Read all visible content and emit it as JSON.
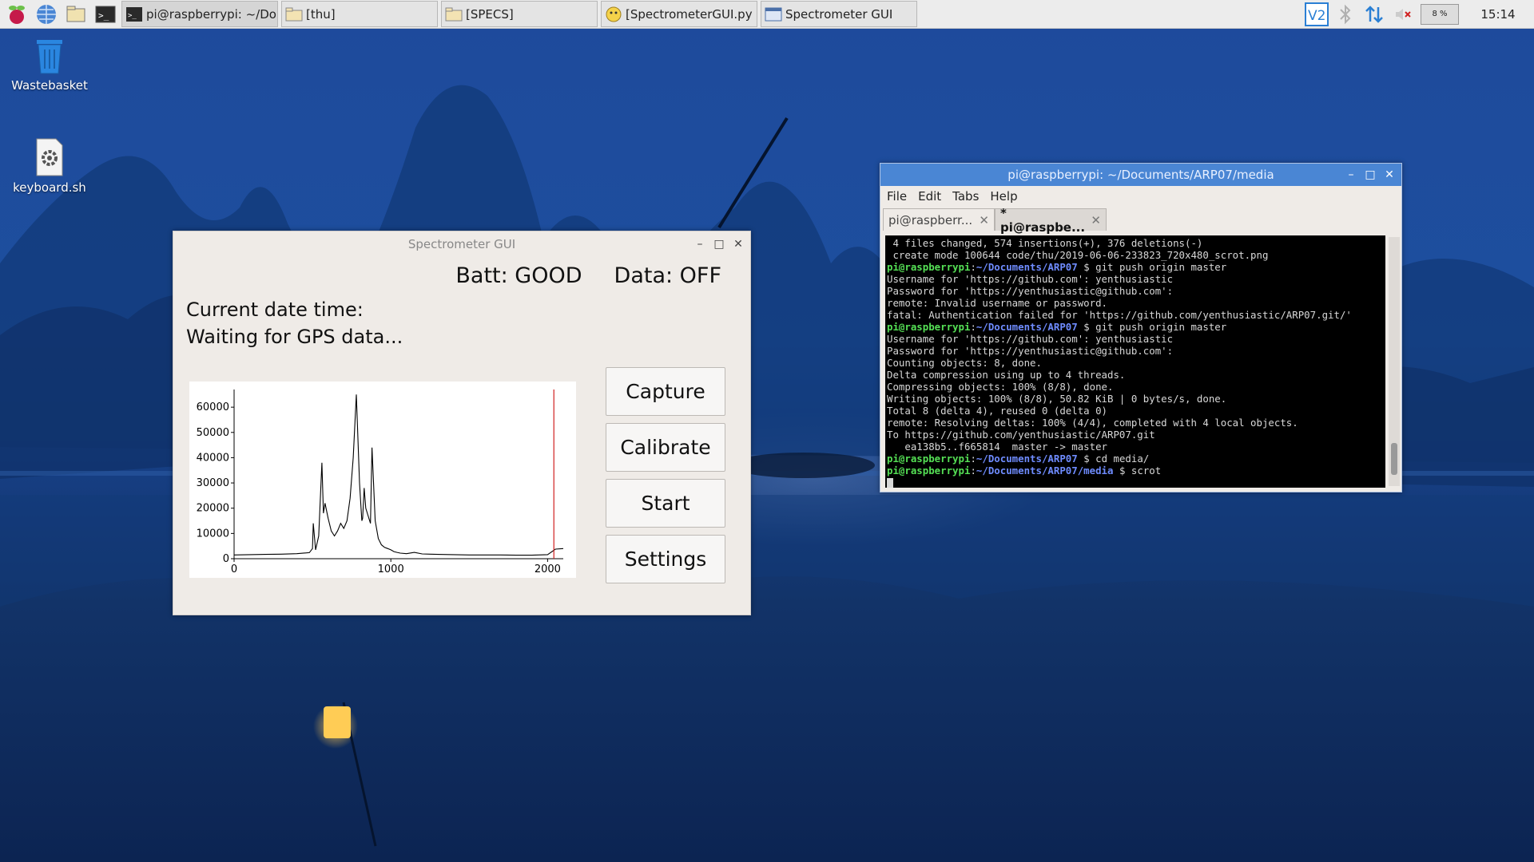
{
  "taskbar": {
    "tasks": [
      {
        "label": "pi@raspberrypi: ~/Do...",
        "icon": "terminal-icon",
        "active": true
      },
      {
        "label": "[thu]",
        "icon": "folder-icon"
      },
      {
        "label": "[SPECS]",
        "icon": "folder-icon"
      },
      {
        "label": "[SpectrometerGUI.py ...",
        "icon": "python-editor-icon"
      },
      {
        "label": "Spectrometer GUI",
        "icon": "window-icon"
      }
    ],
    "cpu": "8 %",
    "clock": "15:14"
  },
  "desktop": {
    "wastebasket": "Wastebasket",
    "keyboard": "keyboard.sh"
  },
  "spectrometer": {
    "title": "Spectrometer GUI",
    "batt": "Batt: GOOD",
    "data": "Data: OFF",
    "datetime_label": "Current date time:",
    "gps_status": "Waiting for GPS data...",
    "buttons": {
      "capture": "Capture",
      "calibrate": "Calibrate",
      "start": "Start",
      "settings": "Settings"
    }
  },
  "chart_data": {
    "type": "line",
    "title": "",
    "xlabel": "",
    "ylabel": "",
    "xlim": [
      0,
      2100
    ],
    "ylim": [
      0,
      67000
    ],
    "xticks": [
      0,
      1000,
      2000
    ],
    "yticks": [
      0,
      10000,
      20000,
      30000,
      40000,
      50000,
      60000
    ],
    "marker_line_x": 2040,
    "marker_color": "#d02020",
    "series": [
      {
        "x": [
          0,
          100,
          200,
          300,
          400,
          480,
          500,
          505,
          520,
          540,
          560,
          570,
          580,
          600,
          620,
          640,
          660,
          680,
          700,
          720,
          740,
          760,
          780,
          800,
          810,
          815,
          820,
          830,
          840,
          860,
          870,
          880,
          900,
          920,
          940,
          960,
          980,
          1000,
          1020,
          1040,
          1060,
          1100,
          1150,
          1200,
          1250,
          1300,
          1400,
          1500,
          1600,
          1700,
          1800,
          1900,
          2000,
          2050,
          2100
        ],
        "y": [
          1500,
          1600,
          1700,
          1800,
          2000,
          2400,
          4000,
          14000,
          3500,
          9000,
          38000,
          18000,
          22000,
          16000,
          11000,
          9000,
          11000,
          14000,
          12000,
          15000,
          24000,
          40000,
          65000,
          30000,
          20000,
          15000,
          16000,
          28000,
          20000,
          16000,
          14000,
          44000,
          15000,
          8000,
          5500,
          4500,
          4000,
          3500,
          2800,
          2500,
          2200,
          2000,
          2500,
          1900,
          1800,
          1700,
          1600,
          1500,
          1500,
          1500,
          1400,
          1400,
          1600,
          3800,
          4000
        ]
      }
    ]
  },
  "terminal": {
    "title": "pi@raspberrypi: ~/Documents/ARP07/media",
    "menu": [
      "File",
      "Edit",
      "Tabs",
      "Help"
    ],
    "tabs": [
      "pi@raspberr...",
      "* pi@raspbe..."
    ],
    "prompt_user": "pi@raspberrypi",
    "lines": [
      {
        "text": " 4 files changed, 574 insertions(+), 376 deletions(-)"
      },
      {
        "text": " create mode 100644 code/thu/2019-06-06-233823_720x480_scrot.png"
      },
      {
        "prompt": true,
        "path": "~/Documents/ARP07",
        "cmd": "git push origin master"
      },
      {
        "text": "Username for 'https://github.com': yenthusiastic"
      },
      {
        "text": "Password for 'https://yenthusiastic@github.com':"
      },
      {
        "text": "remote: Invalid username or password."
      },
      {
        "text": "fatal: Authentication failed for 'https://github.com/yenthusiastic/ARP07.git/'"
      },
      {
        "prompt": true,
        "path": "~/Documents/ARP07",
        "cmd": "git push origin master"
      },
      {
        "text": "Username for 'https://github.com': yenthusiastic"
      },
      {
        "text": "Password for 'https://yenthusiastic@github.com':"
      },
      {
        "text": "Counting objects: 8, done."
      },
      {
        "text": "Delta compression using up to 4 threads."
      },
      {
        "text": "Compressing objects: 100% (8/8), done."
      },
      {
        "text": "Writing objects: 100% (8/8), 50.82 KiB | 0 bytes/s, done."
      },
      {
        "text": "Total 8 (delta 4), reused 0 (delta 0)"
      },
      {
        "text": "remote: Resolving deltas: 100% (4/4), completed with 4 local objects."
      },
      {
        "text": "To https://github.com/yenthusiastic/ARP07.git"
      },
      {
        "text": "   ea138b5..f665814  master -> master"
      },
      {
        "prompt": true,
        "path": "~/Documents/ARP07",
        "cmd": "cd media/"
      },
      {
        "prompt": true,
        "path": "~/Documents/ARP07/media",
        "cmd": "scrot"
      }
    ]
  }
}
